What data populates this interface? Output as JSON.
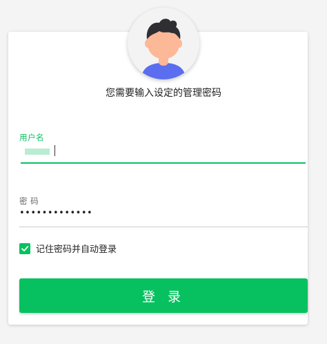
{
  "prompt": {
    "text": "您需要输入设定的管理密码"
  },
  "username": {
    "label": "用户名",
    "value": ""
  },
  "password": {
    "label": "密 码",
    "value": "•••••••••••••"
  },
  "remember": {
    "label": "记住密码并自动登录",
    "checked": true
  },
  "login": {
    "label": "登 录"
  },
  "icons": {
    "avatar": "user-avatar-icon",
    "check": "check-icon"
  },
  "colors": {
    "accent": "#07c160",
    "avatar_shirt": "#5b6ef0",
    "avatar_skin": "#fdb897",
    "avatar_hair": "#2f2f33"
  }
}
